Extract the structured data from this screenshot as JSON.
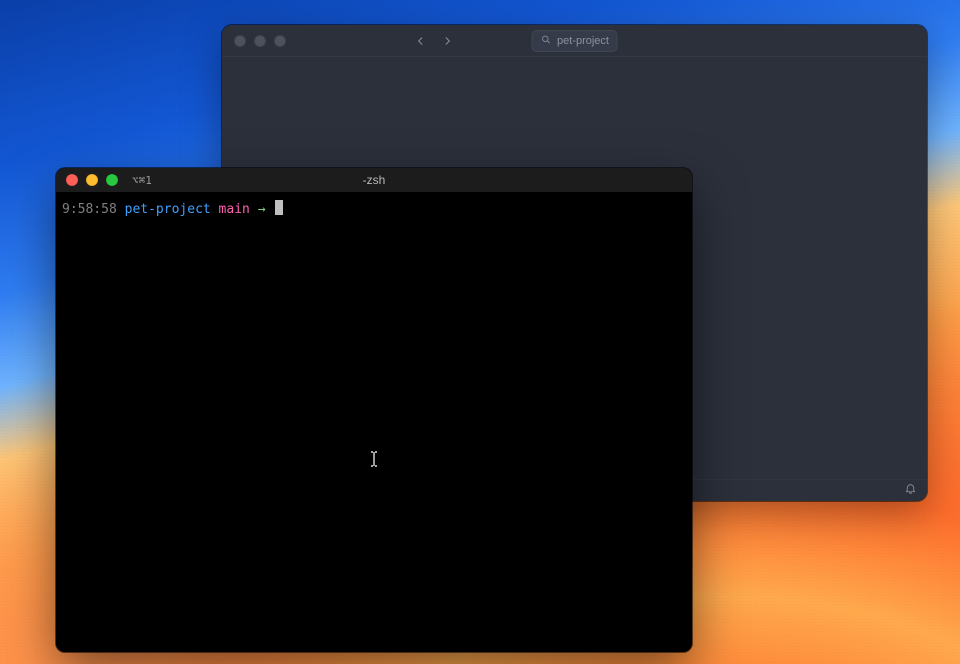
{
  "vscode": {
    "search_placeholder": "pet-project",
    "search_icon": "search-icon",
    "nav": {
      "back": "back-arrow",
      "forward": "forward-arrow"
    },
    "status": {
      "bell": "bell-icon"
    }
  },
  "terminal": {
    "tab_label": "⌥⌘1",
    "title": "-zsh",
    "prompt": {
      "time": "9:58:58",
      "dir": "pet-project",
      "branch": "main",
      "arrow": "→"
    }
  }
}
